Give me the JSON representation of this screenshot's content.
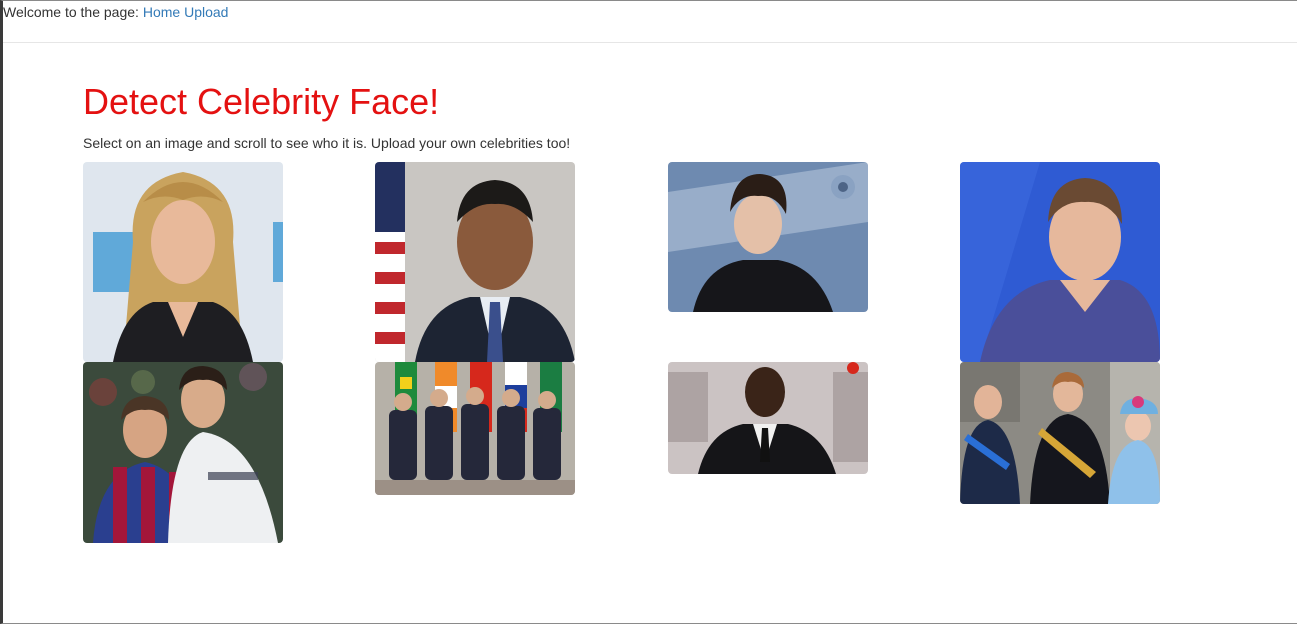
{
  "nav": {
    "welcome_text": "Welcome to the page:",
    "home_link": "Home",
    "upload_link": "Upload"
  },
  "main": {
    "title": "Detect Celebrity Face!",
    "subtitle": "Select on an image and scroll to see who it is. Upload your own celebrities too!"
  },
  "photo_tiles": [
    {
      "id": 1,
      "icon": "woman-blonde-portrait"
    },
    {
      "id": 2,
      "icon": "man-suit-flag-portrait"
    },
    {
      "id": 3,
      "icon": "man-dark-hair-portrait"
    },
    {
      "id": 4,
      "icon": "man-blue-sweater-portrait"
    },
    {
      "id": 5,
      "icon": "two-football-players"
    },
    {
      "id": 6,
      "icon": "group-of-five-leaders"
    },
    {
      "id": 7,
      "icon": "man-suit-smiling-portrait"
    },
    {
      "id": 8,
      "icon": "royal-family-group"
    }
  ],
  "colors": {
    "title": "#e41111",
    "link": "#337ab7",
    "text": "#333333"
  }
}
